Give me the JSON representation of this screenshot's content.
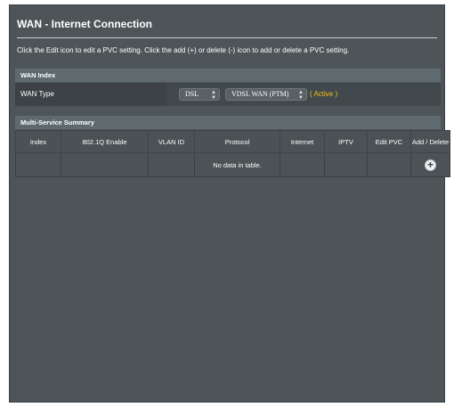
{
  "page": {
    "title": "WAN - Internet Connection",
    "description": "Click the Edit icon to edit a PVC setting. Click the add (+) or delete (-) icon to add or delete a PVC setting."
  },
  "wan_index": {
    "section_label": "WAN Index",
    "wan_type_label": "WAN Type",
    "type_select_value": "DSL",
    "mode_select_value": "VDSL WAN (PTM)",
    "status_text": "( Active )",
    "status_color": "#f3c014"
  },
  "summary": {
    "section_label": "Multi-Service Summary",
    "columns": [
      "Index",
      "802.1Q Enable",
      "VLAN ID",
      "Protocol",
      "Internet",
      "IPTV",
      "Edit PVC",
      "Add / Delete"
    ],
    "empty_message": "No data in table.",
    "add_icon": "add-circle-icon"
  }
}
